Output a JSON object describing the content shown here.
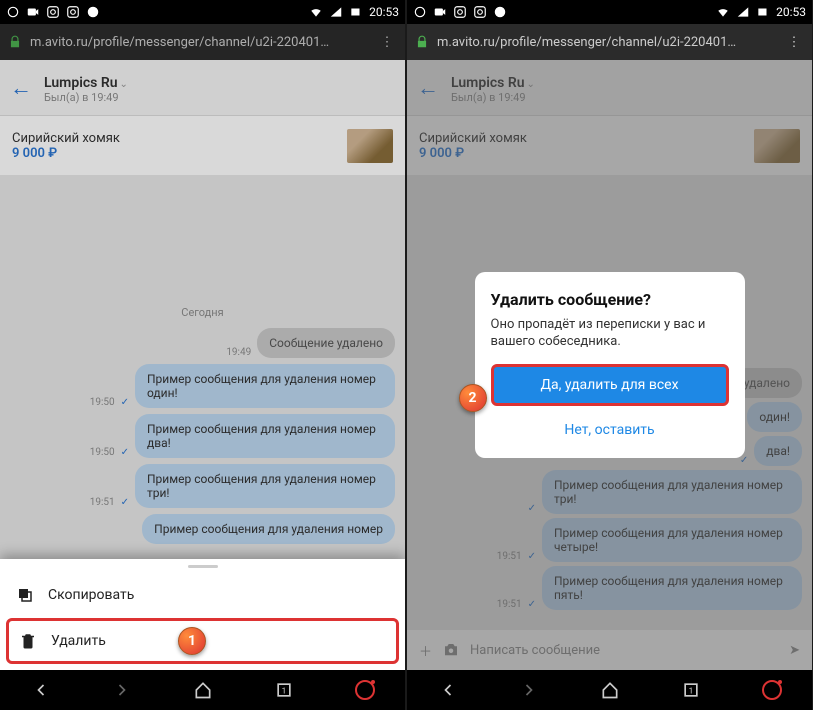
{
  "status": {
    "time": "20:53"
  },
  "url": "m.avito.ru/profile/messenger/channel/u2i-220401…",
  "header": {
    "title": "Lumpics Ru",
    "sub": "Был(а) в 19:49"
  },
  "listing": {
    "name": "Сирийский хомяк",
    "price": "9 000 ₽"
  },
  "date_sep": "Сегодня",
  "messages_left": [
    {
      "time": "19:49",
      "text": "Сообщение удалено",
      "sys": true
    },
    {
      "time": "19:50",
      "check": true,
      "text": "Пример сообщения для удаления номер один!"
    },
    {
      "time": "19:50",
      "check": true,
      "text": "Пример сообщения для удаления номер два!"
    },
    {
      "time": "19:51",
      "check": true,
      "text": "Пример сообщения для удаления номер три!"
    },
    {
      "time": "",
      "text": "Пример сообщения для удаления номер"
    }
  ],
  "messages_right": [
    {
      "time": "",
      "text": "удалено",
      "sys": true
    },
    {
      "time": "",
      "check": true,
      "text": "один!"
    },
    {
      "time": "",
      "check": true,
      "text": "два!"
    },
    {
      "time": "",
      "check": true,
      "text": "Пример сообщения для удаления номер три!"
    },
    {
      "time": "19:51",
      "check": true,
      "text": "Пример сообщения для удаления номер четыре!"
    },
    {
      "time": "19:51",
      "check": true,
      "text": "Пример сообщения для удаления номер пять!"
    }
  ],
  "context": {
    "copy": "Скопировать",
    "delete": "Удалить"
  },
  "dialog": {
    "title": "Удалить сообщение?",
    "text": "Оно пропадёт из переписки у вас и вашего собеседника.",
    "yes": "Да, удалить для всех",
    "no": "Нет, оставить"
  },
  "input": {
    "placeholder": "Написать сообщение"
  },
  "markers": {
    "m1": "1",
    "m2": "2"
  }
}
